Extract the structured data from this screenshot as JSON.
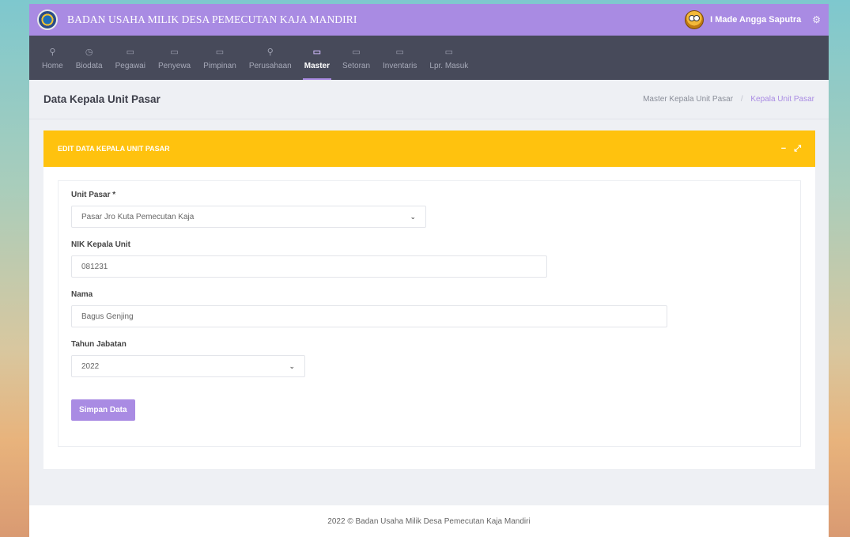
{
  "header": {
    "title": "BADAN USAHA MILIK DESA PEMECUTAN KAJA MANDIRI",
    "user_name": "I Made Angga Saputra",
    "settings_icon": "gear-icon"
  },
  "nav": {
    "items": [
      {
        "label": "Home",
        "icon": "wrench-icon",
        "glyph": "⚲"
      },
      {
        "label": "Biodata",
        "icon": "clock-icon",
        "glyph": "◷"
      },
      {
        "label": "Pegawai",
        "icon": "book-icon",
        "glyph": "▭"
      },
      {
        "label": "Penyewa",
        "icon": "book-icon",
        "glyph": "▭"
      },
      {
        "label": "Pimpinan",
        "icon": "book-icon",
        "glyph": "▭"
      },
      {
        "label": "Perusahaan",
        "icon": "wrench-icon",
        "glyph": "⚲"
      },
      {
        "label": "Master",
        "icon": "book-icon",
        "glyph": "▭",
        "active": true
      },
      {
        "label": "Setoran",
        "icon": "book-icon",
        "glyph": "▭"
      },
      {
        "label": "Inventaris",
        "icon": "book-icon",
        "glyph": "▭"
      },
      {
        "label": "Lpr. Masuk",
        "icon": "book-icon",
        "glyph": "▭"
      }
    ]
  },
  "page": {
    "title": "Data Kepala Unit Pasar",
    "breadcrumb": [
      "Master Kepala Unit Pasar",
      "Kepala Unit Pasar"
    ]
  },
  "card": {
    "title": "EDIT DATA KEPALA UNIT PASAR",
    "minimize_glyph": "−",
    "expand_glyph": "⤢"
  },
  "form": {
    "unit_pasar": {
      "label": "Unit Pasar *",
      "value": "Pasar Jro Kuta Pemecutan Kaja"
    },
    "nik": {
      "label": "NIK Kepala Unit",
      "value": "081231"
    },
    "nama": {
      "label": "Nama",
      "value": "Bagus Genjing"
    },
    "tahun": {
      "label": "Tahun Jabatan",
      "value": "2022"
    },
    "submit_label": "Simpan Data"
  },
  "footer": {
    "text": "2022 © Badan Usaha Milik Desa Pemecutan Kaja Mandiri"
  },
  "colors": {
    "accent": "#a98be3",
    "navbar": "#474a5a",
    "card_header": "#ffc20e"
  }
}
